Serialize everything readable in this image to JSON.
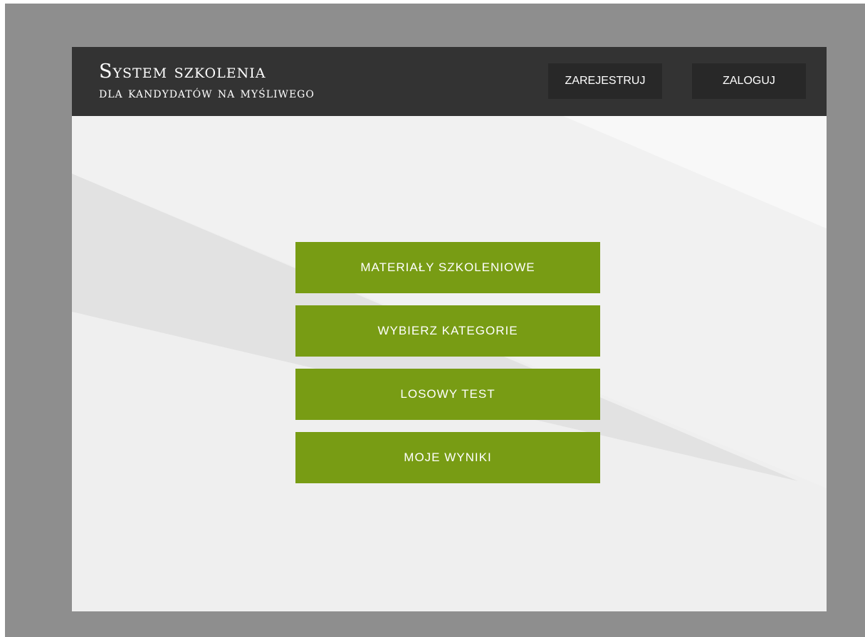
{
  "header": {
    "title_line1": "System szkolenia",
    "title_line2": "dla kandydatów na myśliwego",
    "register_label": "ZAREJESTRUJ",
    "login_label": "ZALOGUJ"
  },
  "menu": {
    "items": [
      {
        "label": "MATERIAŁY SZKOLENIOWE"
      },
      {
        "label": "WYBIERZ KATEGORIE"
      },
      {
        "label": "LOSOWY TEST"
      },
      {
        "label": "MOJE WYNIKI"
      }
    ]
  },
  "colors": {
    "frame": "#8e8e8e",
    "header": "#333333",
    "header_button": "#282828",
    "accent_green": "#789c14",
    "content_bg": "#f1f1f1"
  }
}
